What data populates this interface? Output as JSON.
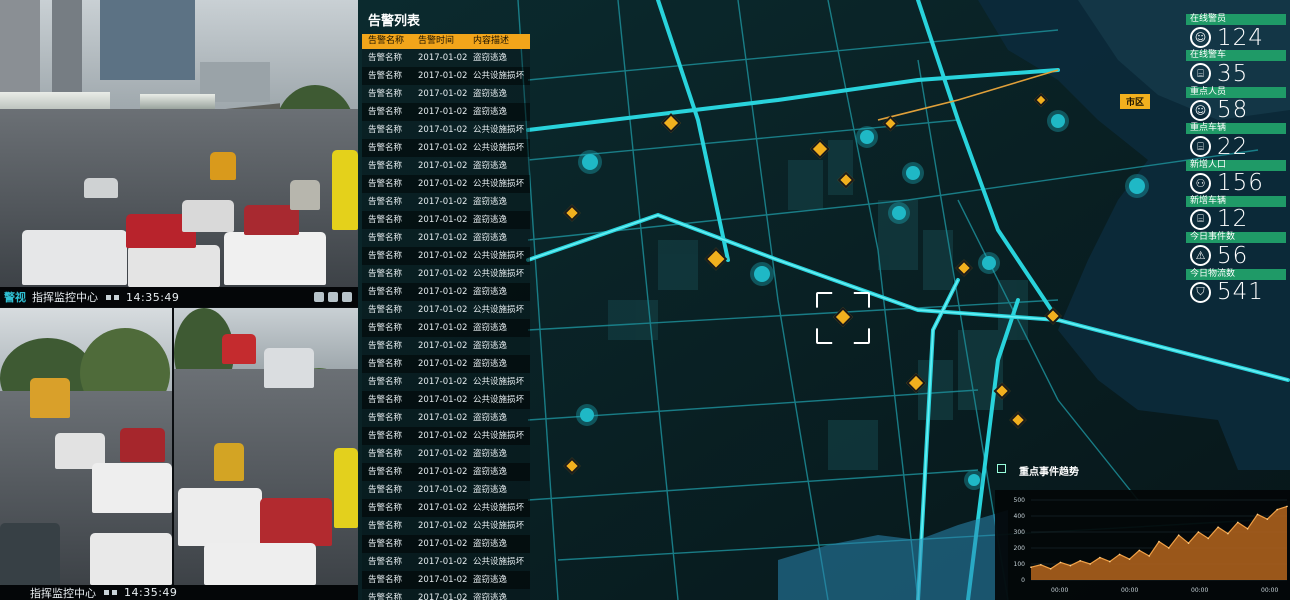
{
  "cameras": {
    "top_bar": {
      "tag": "警视",
      "title": "指挥监控中心",
      "time": "14:35:49"
    },
    "bottom_bar": {
      "title": "指挥监控中心",
      "time": "14:35:49"
    }
  },
  "alarm_list": {
    "title": "告警列表",
    "columns": [
      "告警名称",
      "告警时间",
      "内容描述"
    ],
    "rows": [
      [
        "告警名称",
        "2017-01-02",
        "盗窃逃逸"
      ],
      [
        "告警名称",
        "2017-01-02",
        "公共设施损坏"
      ],
      [
        "告警名称",
        "2017-01-02",
        "盗窃逃逸"
      ],
      [
        "告警名称",
        "2017-01-02",
        "盗窃逃逸"
      ],
      [
        "告警名称",
        "2017-01-02",
        "公共设施损坏"
      ],
      [
        "告警名称",
        "2017-01-02",
        "公共设施损坏"
      ],
      [
        "告警名称",
        "2017-01-02",
        "盗窃逃逸"
      ],
      [
        "告警名称",
        "2017-01-02",
        "公共设施损坏"
      ],
      [
        "告警名称",
        "2017-01-02",
        "盗窃逃逸"
      ],
      [
        "告警名称",
        "2017-01-02",
        "盗窃逃逸"
      ],
      [
        "告警名称",
        "2017-01-02",
        "盗窃逃逸"
      ],
      [
        "告警名称",
        "2017-01-02",
        "公共设施损坏"
      ],
      [
        "告警名称",
        "2017-01-02",
        "公共设施损坏"
      ],
      [
        "告警名称",
        "2017-01-02",
        "盗窃逃逸"
      ],
      [
        "告警名称",
        "2017-01-02",
        "公共设施损坏"
      ],
      [
        "告警名称",
        "2017-01-02",
        "盗窃逃逸"
      ],
      [
        "告警名称",
        "2017-01-02",
        "盗窃逃逸"
      ],
      [
        "告警名称",
        "2017-01-02",
        "盗窃逃逸"
      ],
      [
        "告警名称",
        "2017-01-02",
        "公共设施损坏"
      ],
      [
        "告警名称",
        "2017-01-02",
        "公共设施损坏"
      ],
      [
        "告警名称",
        "2017-01-02",
        "盗窃逃逸"
      ],
      [
        "告警名称",
        "2017-01-02",
        "公共设施损坏"
      ],
      [
        "告警名称",
        "2017-01-02",
        "盗窃逃逸"
      ],
      [
        "告警名称",
        "2017-01-02",
        "盗窃逃逸"
      ],
      [
        "告警名称",
        "2017-01-02",
        "盗窃逃逸"
      ],
      [
        "告警名称",
        "2017-01-02",
        "公共设施损坏"
      ],
      [
        "告警名称",
        "2017-01-02",
        "公共设施损坏"
      ],
      [
        "告警名称",
        "2017-01-02",
        "盗窃逃逸"
      ],
      [
        "告警名称",
        "2017-01-02",
        "公共设施损坏"
      ],
      [
        "告警名称",
        "2017-01-02",
        "盗窃逃逸"
      ],
      [
        "告警名称",
        "2017-01-02",
        "盗窃逃逸"
      ],
      [
        "告警名称",
        "2017-01-02",
        "公共设施损坏"
      ]
    ]
  },
  "stats": [
    {
      "label": "在线警员",
      "value": "124",
      "icon": "person-icon"
    },
    {
      "label": "在线警车",
      "value": "35",
      "icon": "car-icon"
    },
    {
      "label": "重点人员",
      "value": "58",
      "icon": "person-icon"
    },
    {
      "label": "重点车辆",
      "value": "22",
      "icon": "car-icon"
    },
    {
      "label": "新增人口",
      "value": "156",
      "icon": "people-icon"
    },
    {
      "label": "新增车辆",
      "value": "12",
      "icon": "car-icon"
    },
    {
      "label": "今日事件数",
      "value": "56",
      "icon": "warning-icon"
    },
    {
      "label": "今日物流数",
      "value": "541",
      "icon": "shield-icon"
    }
  ],
  "map": {
    "district_label": "市区"
  },
  "trend": {
    "title": "重点事件趋势",
    "chart_data": {
      "type": "area",
      "title": "重点事件趋势",
      "y_ticks": [
        "500",
        "400",
        "300",
        "200",
        "100",
        "0"
      ],
      "ylim": [
        0,
        500
      ],
      "x_tick_label": "00:00",
      "values": [
        80,
        95,
        70,
        110,
        90,
        120,
        100,
        140,
        115,
        160,
        130,
        185,
        150,
        240,
        200,
        280,
        230,
        300,
        260,
        330,
        290,
        360,
        320,
        410,
        380,
        440,
        460
      ]
    }
  },
  "colors": {
    "accent": "#f2a51a",
    "road": "#29d3dc",
    "stat_label": "#1f9a67",
    "trend_fill": "#b5651d"
  }
}
